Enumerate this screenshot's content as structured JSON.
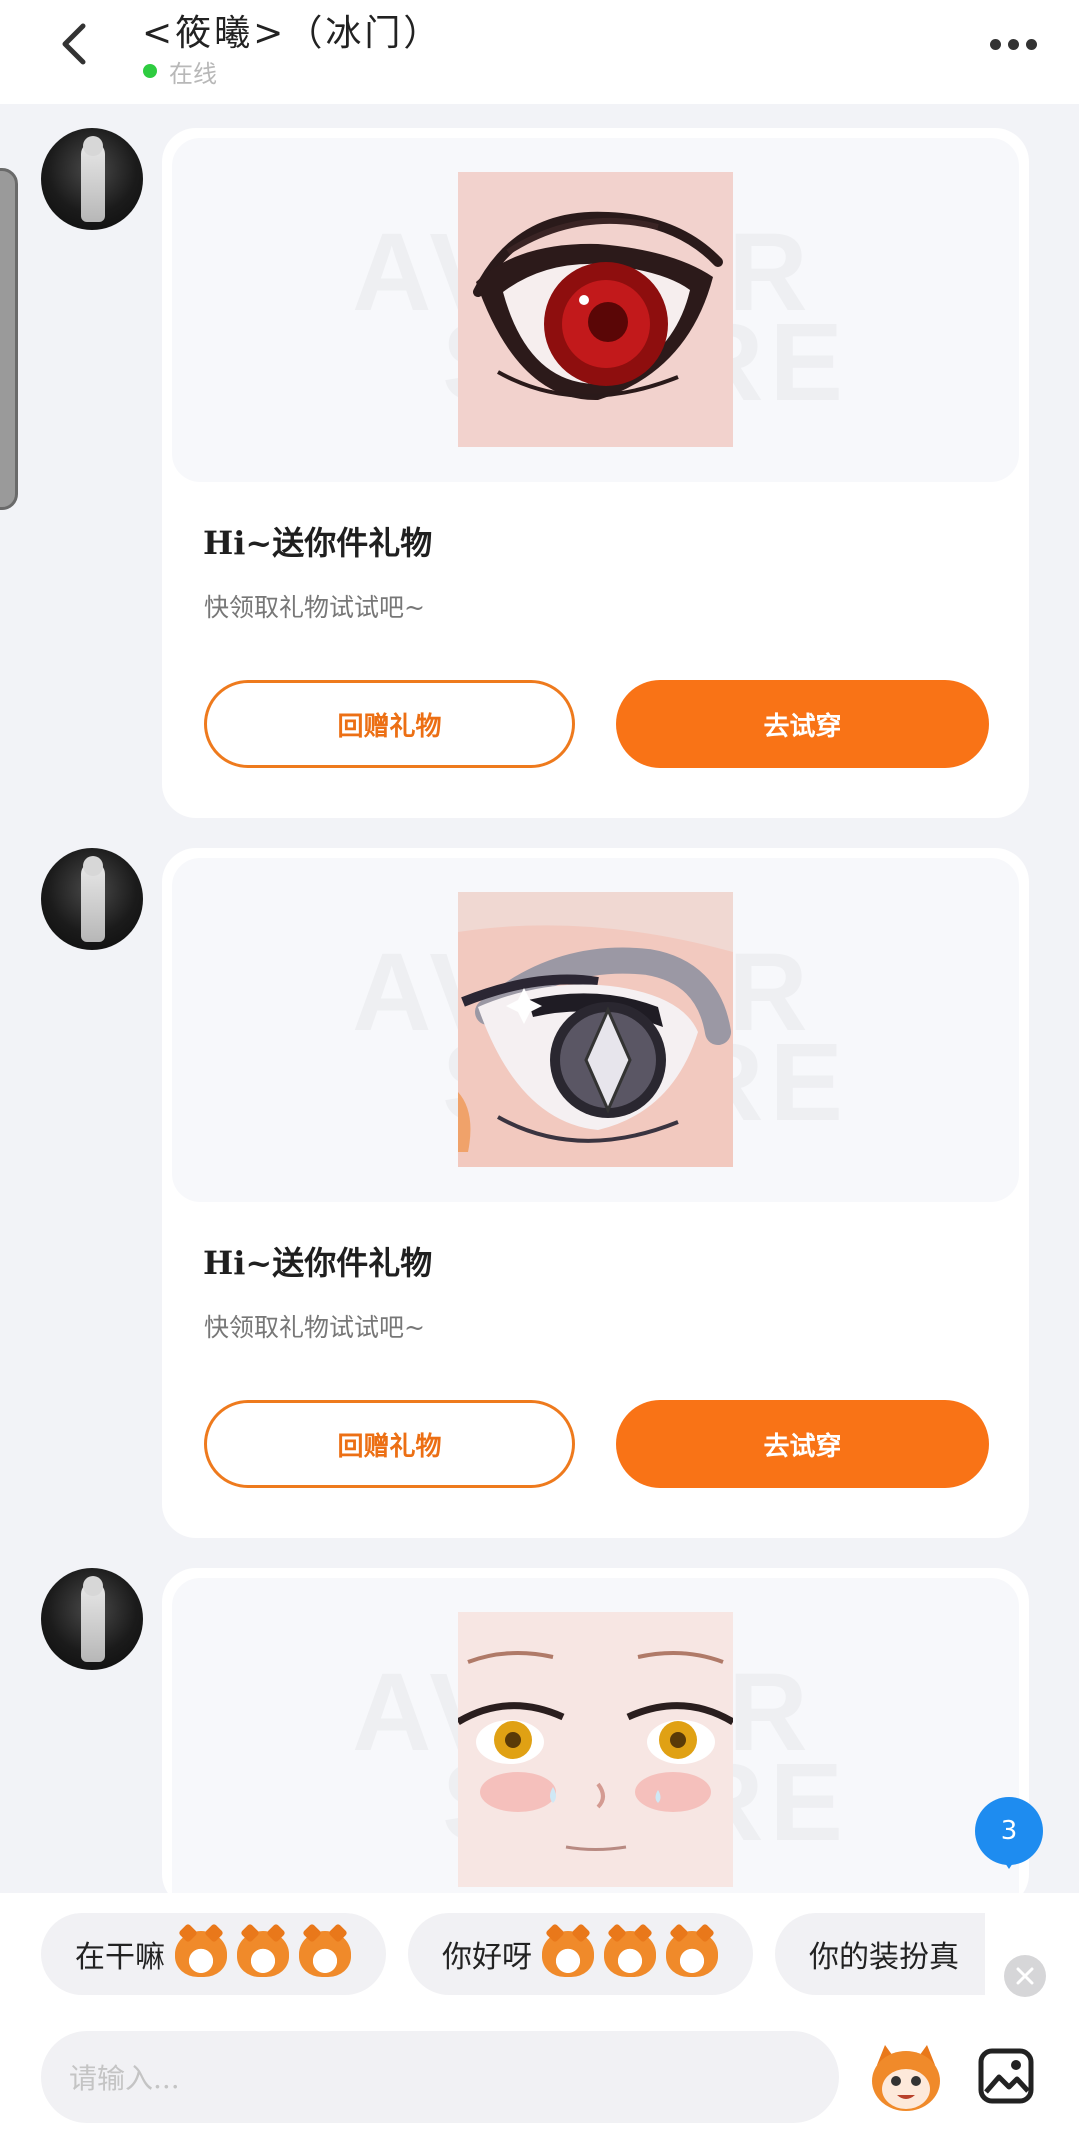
{
  "header": {
    "title": "<筱曦>（冰门）",
    "status_text": "在线",
    "status_color": "#2ecc40"
  },
  "messages": [
    {
      "image": "red-anime-eye",
      "title": "Hi~送你件礼物",
      "subtitle": "快领取礼物试试吧~",
      "return_label": "回赠礼物",
      "try_label": "去试穿"
    },
    {
      "image": "silver-diamond-anime-eye",
      "title": "Hi~送你件礼物",
      "subtitle": "快领取礼物试试吧~",
      "return_label": "回赠礼物",
      "try_label": "去试穿"
    },
    {
      "image": "anime-face-yellow-eyes"
    }
  ],
  "watermark": {
    "line1": "AVATAR",
    "line2": "STORE"
  },
  "unread_badge": "3",
  "quick_replies": [
    {
      "text": "在干嘛"
    },
    {
      "text": "你好呀"
    },
    {
      "text": "你的装扮真"
    }
  ],
  "input": {
    "placeholder": "请输入..."
  },
  "colors": {
    "accent": "#f97316",
    "badge": "#1e8cf0"
  },
  "icons": {
    "back": "chevron-left-icon",
    "more": "more-dots-icon",
    "close": "close-icon",
    "mascot": "mascot-emoji-icon",
    "gallery": "image-gallery-icon"
  }
}
